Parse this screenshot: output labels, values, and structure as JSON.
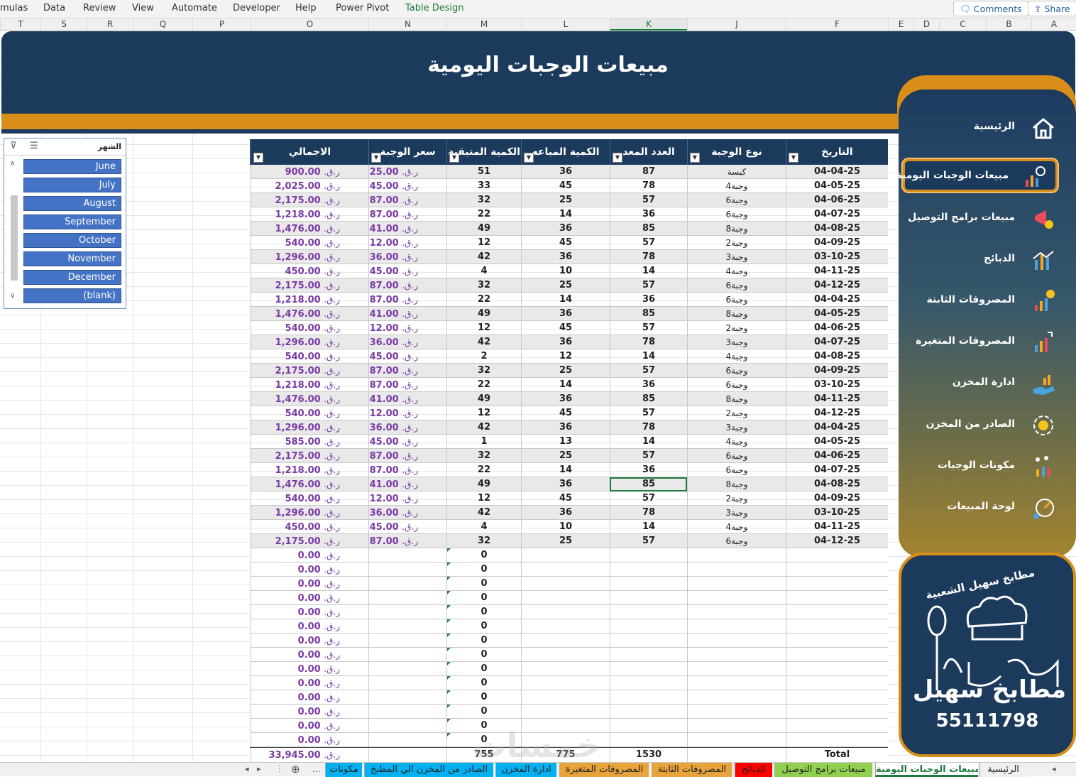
{
  "ribbon": {
    "tabs": [
      "mulas",
      "Data",
      "Review",
      "View",
      "Automate",
      "Developer",
      "Help",
      "Power Pivot",
      "Table Design"
    ],
    "comments_label": "Comments",
    "share_label": "Share"
  },
  "columns": [
    "T",
    "S",
    "R",
    "Q",
    "P",
    "O",
    "N",
    "M",
    "L",
    "K",
    "J",
    "F",
    "E",
    "D",
    "C",
    "B",
    "A"
  ],
  "title": "مبيعات الوجبات اليومية",
  "slicer": {
    "title": "الشهر",
    "items": [
      "June",
      "July",
      "August",
      "September",
      "October",
      "November",
      "December",
      "(blank)"
    ]
  },
  "table": {
    "headers": {
      "date": "التاريخ",
      "meal_type": "نوع الوجبة",
      "prepared": "العدد المعد",
      "sold": "الكمية المباعه",
      "remaining": "الكمية المتبقية",
      "price": "سعر الوجبة",
      "total": "الاجمالي"
    },
    "currency": "ر.ق.",
    "rows": [
      {
        "date": "04-04-25",
        "meal": "كبسة",
        "prepared": "87",
        "sold": "36",
        "remaining": "51",
        "price": "25.00",
        "total": "900.00"
      },
      {
        "date": "04-05-25",
        "meal": "وجبة4",
        "prepared": "78",
        "sold": "45",
        "remaining": "33",
        "price": "45.00",
        "total": "2,025.00"
      },
      {
        "date": "04-06-25",
        "meal": "وجبة6",
        "prepared": "57",
        "sold": "25",
        "remaining": "32",
        "price": "87.00",
        "total": "2,175.00"
      },
      {
        "date": "04-07-25",
        "meal": "وجبة6",
        "prepared": "36",
        "sold": "14",
        "remaining": "22",
        "price": "87.00",
        "total": "1,218.00"
      },
      {
        "date": "04-08-25",
        "meal": "وجبة8",
        "prepared": "85",
        "sold": "36",
        "remaining": "49",
        "price": "41.00",
        "total": "1,476.00"
      },
      {
        "date": "04-09-25",
        "meal": "وجبة2",
        "prepared": "57",
        "sold": "45",
        "remaining": "12",
        "price": "12.00",
        "total": "540.00"
      },
      {
        "date": "03-10-25",
        "meal": "وجبة3",
        "prepared": "78",
        "sold": "36",
        "remaining": "42",
        "price": "36.00",
        "total": "1,296.00"
      },
      {
        "date": "04-11-25",
        "meal": "وجبة4",
        "prepared": "14",
        "sold": "10",
        "remaining": "4",
        "price": "45.00",
        "total": "450.00"
      },
      {
        "date": "04-12-25",
        "meal": "وجبة6",
        "prepared": "57",
        "sold": "25",
        "remaining": "32",
        "price": "87.00",
        "total": "2,175.00"
      },
      {
        "date": "04-04-25",
        "meal": "وجبة6",
        "prepared": "36",
        "sold": "14",
        "remaining": "22",
        "price": "87.00",
        "total": "1,218.00"
      },
      {
        "date": "04-05-25",
        "meal": "وجبة8",
        "prepared": "85",
        "sold": "36",
        "remaining": "49",
        "price": "41.00",
        "total": "1,476.00"
      },
      {
        "date": "04-06-25",
        "meal": "وجبة2",
        "prepared": "57",
        "sold": "45",
        "remaining": "12",
        "price": "12.00",
        "total": "540.00"
      },
      {
        "date": "04-07-25",
        "meal": "وجبة3",
        "prepared": "78",
        "sold": "36",
        "remaining": "42",
        "price": "36.00",
        "total": "1,296.00"
      },
      {
        "date": "04-08-25",
        "meal": "وجبة4",
        "prepared": "14",
        "sold": "12",
        "remaining": "2",
        "price": "45.00",
        "total": "540.00"
      },
      {
        "date": "04-09-25",
        "meal": "وجبة6",
        "prepared": "57",
        "sold": "25",
        "remaining": "32",
        "price": "87.00",
        "total": "2,175.00"
      },
      {
        "date": "03-10-25",
        "meal": "وجبة6",
        "prepared": "36",
        "sold": "14",
        "remaining": "22",
        "price": "87.00",
        "total": "1,218.00"
      },
      {
        "date": "04-11-25",
        "meal": "وجبة8",
        "prepared": "85",
        "sold": "36",
        "remaining": "49",
        "price": "41.00",
        "total": "1,476.00"
      },
      {
        "date": "04-12-25",
        "meal": "وجبة2",
        "prepared": "57",
        "sold": "45",
        "remaining": "12",
        "price": "12.00",
        "total": "540.00"
      },
      {
        "date": "04-04-25",
        "meal": "وجبة3",
        "prepared": "78",
        "sold": "36",
        "remaining": "42",
        "price": "36.00",
        "total": "1,296.00"
      },
      {
        "date": "04-05-25",
        "meal": "وجبة4",
        "prepared": "14",
        "sold": "13",
        "remaining": "1",
        "price": "45.00",
        "total": "585.00"
      },
      {
        "date": "04-06-25",
        "meal": "وجبة6",
        "prepared": "57",
        "sold": "25",
        "remaining": "32",
        "price": "87.00",
        "total": "2,175.00"
      },
      {
        "date": "04-07-25",
        "meal": "وجبة6",
        "prepared": "36",
        "sold": "14",
        "remaining": "22",
        "price": "87.00",
        "total": "1,218.00"
      },
      {
        "date": "04-08-25",
        "meal": "وجبة8",
        "prepared": "85",
        "sold": "36",
        "remaining": "49",
        "price": "41.00",
        "total": "1,476.00"
      },
      {
        "date": "04-09-25",
        "meal": "وجبة2",
        "prepared": "57",
        "sold": "45",
        "remaining": "12",
        "price": "12.00",
        "total": "540.00"
      },
      {
        "date": "03-10-25",
        "meal": "وجبة3",
        "prepared": "78",
        "sold": "36",
        "remaining": "42",
        "price": "36.00",
        "total": "1,296.00"
      },
      {
        "date": "04-11-25",
        "meal": "وجبة4",
        "prepared": "14",
        "sold": "10",
        "remaining": "4",
        "price": "45.00",
        "total": "450.00"
      },
      {
        "date": "04-12-25",
        "meal": "وجبة6",
        "prepared": "57",
        "sold": "25",
        "remaining": "32",
        "price": "87.00",
        "total": "2,175.00"
      }
    ],
    "empty_rows": 14,
    "empty_remaining": "0",
    "empty_total": "0.00",
    "totals": {
      "label": "Total",
      "prepared": "1530",
      "sold": "775",
      "remaining": "755",
      "total": "33,945.00"
    }
  },
  "sidebar": {
    "items": [
      {
        "label": "الرئيسية",
        "icon": "home-icon"
      },
      {
        "label": "مبيعات الوجبات اليومية",
        "icon": "sales-chart-icon",
        "active": true
      },
      {
        "label": "مبيعات برامج التوصيل",
        "icon": "delivery-megaphone-icon"
      },
      {
        "label": "الذبائح",
        "icon": "bar-chart-icon"
      },
      {
        "label": "المصروفات الثابتة",
        "icon": "fixed-expenses-icon"
      },
      {
        "label": "المصروفات المتغيرة",
        "icon": "variable-expenses-icon"
      },
      {
        "label": "ادارة المخزن",
        "icon": "inventory-hand-icon"
      },
      {
        "label": "الصادر من المخزن",
        "icon": "outflow-cycle-icon"
      },
      {
        "label": "مكونات الوجبات",
        "icon": "ingredients-icon"
      },
      {
        "label": "لوحة المبيعات",
        "icon": "dashboard-icon"
      }
    ],
    "logo_text": "مطابخ سهيل",
    "logo_subtitle": "مطابخ سهيل الشعبية",
    "phone": "55111798"
  },
  "sheet_tabs": [
    {
      "label": "الرئيسية",
      "color": "#f0f0f0"
    },
    {
      "label": "مبيعات الوجبات اليومية",
      "color": "#ffffff",
      "active": true
    },
    {
      "label": "مبيعات برامج التوصيل",
      "color": "#92d050"
    },
    {
      "label": "الذبائح",
      "color": "#ff0000"
    },
    {
      "label": "المصروفات الثابتة",
      "color": "#e8a33a"
    },
    {
      "label": "المصروفات المتغيرة",
      "color": "#e8a33a"
    },
    {
      "label": "ادارة المخزن",
      "color": "#00b0f0"
    },
    {
      "label": "الصادر من المخزن الي المطبخ",
      "color": "#00b0f0"
    },
    {
      "label": "مكونات",
      "color": "#00b0f0"
    }
  ],
  "watermark": "خمسات"
}
